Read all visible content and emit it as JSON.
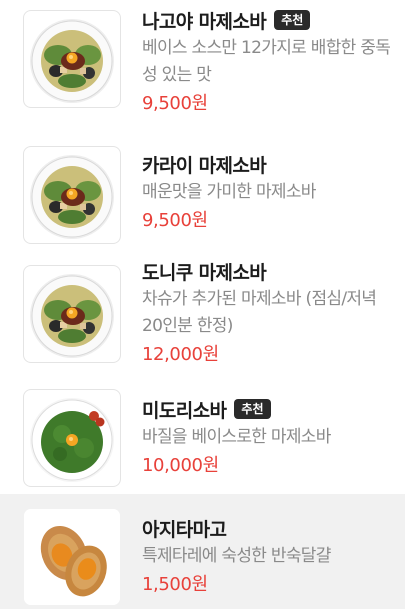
{
  "menu": {
    "items": [
      {
        "name": "나고야 마제소바",
        "badge": "추천",
        "description": "베이스 소스만 12가지로 배합한 중독성 있는 맛",
        "price": "9,500원"
      },
      {
        "name": "카라이 마제소바",
        "badge": "",
        "description": "매운맛을 가미한 마제소바",
        "price": "9,500원"
      },
      {
        "name": "도니쿠 마제소바",
        "badge": "",
        "description": "차슈가 추가된 마제소바 (점심/저녁 20인분 한정)",
        "price": "12,000원"
      },
      {
        "name": "미도리소바",
        "badge": "추천",
        "description": "바질을 베이스로한 마제소바",
        "price": "10,000원"
      },
      {
        "name": "아지타마고",
        "badge": "",
        "description": "특제타레에 숙성한 반숙달걀",
        "price": "1,500원"
      }
    ]
  },
  "colors": {
    "price": "#e8413a",
    "badge_bg": "#2a2a2a",
    "description": "#8a8a8a",
    "name": "#1c1c1c"
  }
}
